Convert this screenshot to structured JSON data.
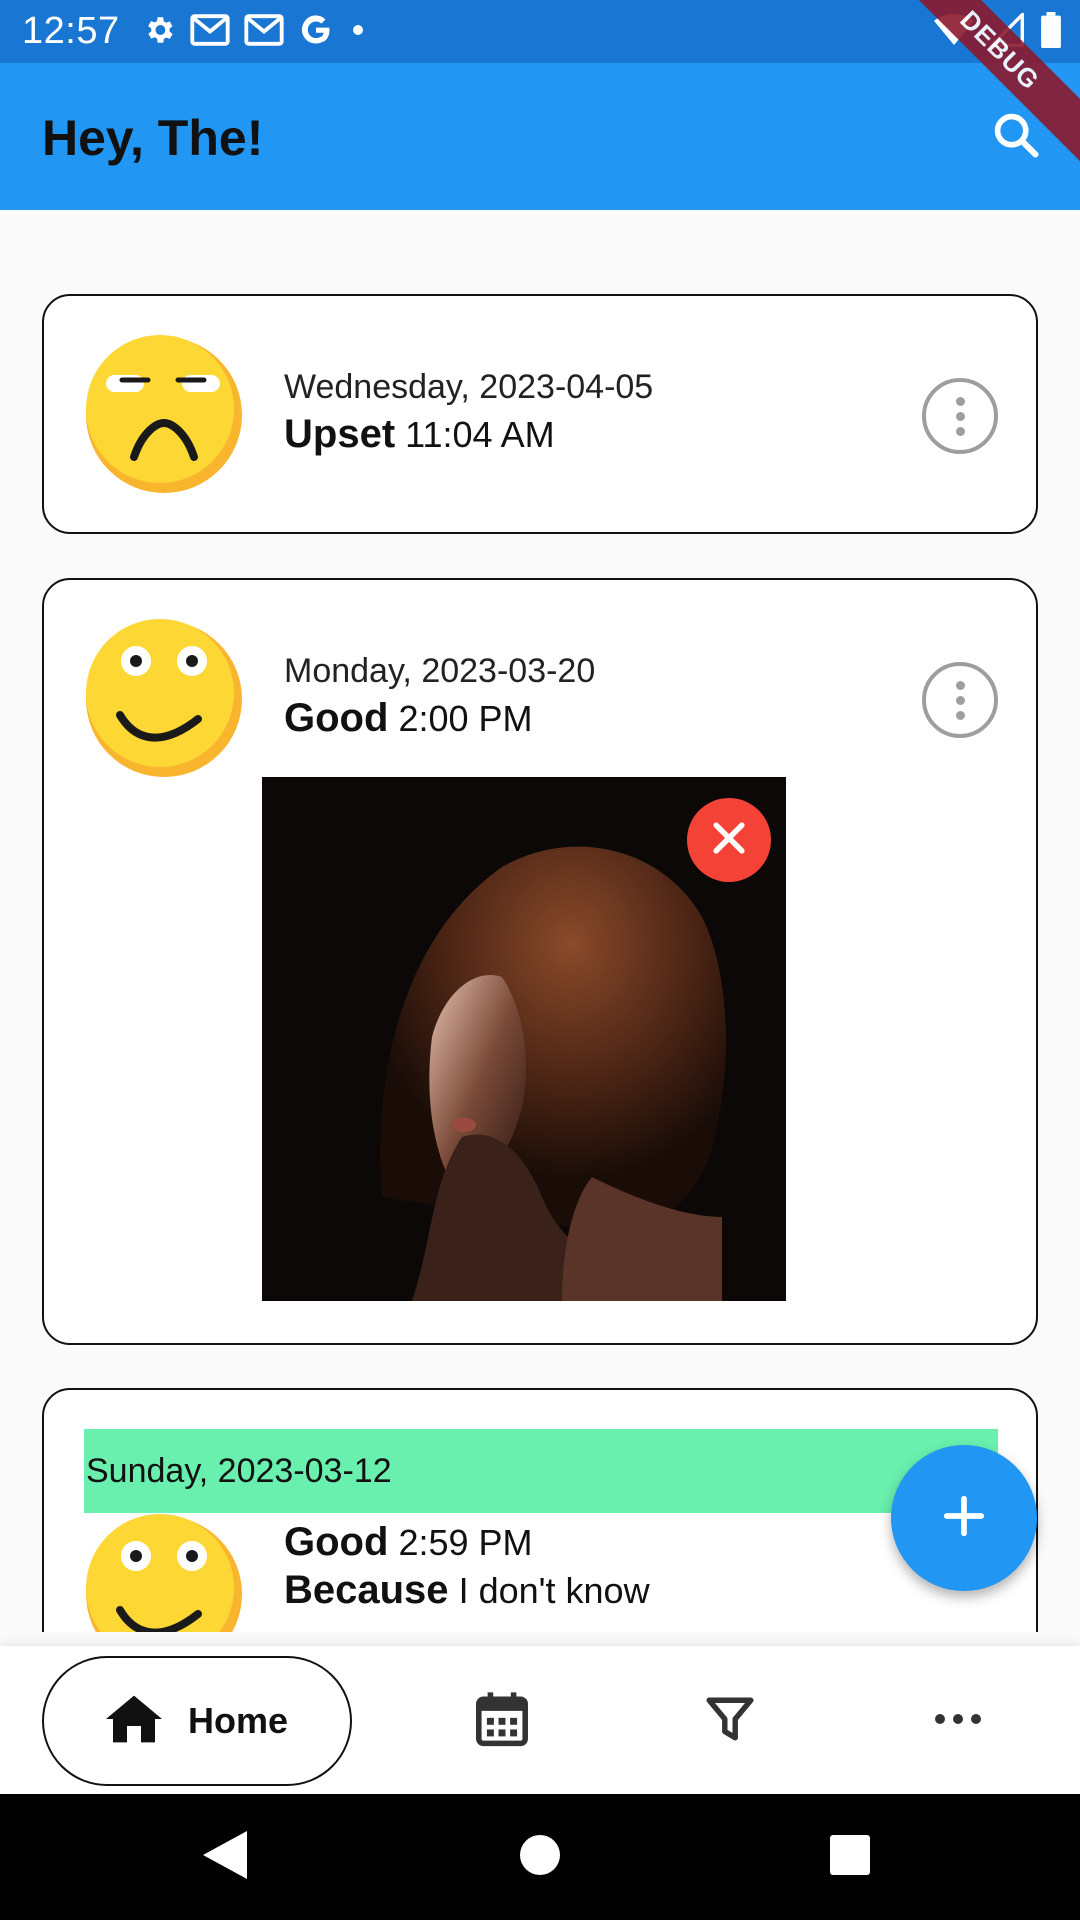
{
  "status_bar": {
    "time": "12:57",
    "left_icons": [
      "gear-icon",
      "gmail-icon",
      "gmail-icon",
      "google-icon",
      "dot-icon"
    ],
    "right_icons": [
      "wifi-icon",
      "signal-icon",
      "battery-icon"
    ]
  },
  "debug_banner": "DEBUG",
  "app_bar": {
    "title": "Hey, The!",
    "search_icon": "search-icon"
  },
  "entries": [
    {
      "date": "Wednesday, 2023-04-05",
      "mood": "Upset",
      "time": "11:04 AM",
      "emoji": "upset-face"
    },
    {
      "date": "Monday, 2023-03-20",
      "mood": "Good",
      "time": "2:00 PM",
      "emoji": "smiling-face",
      "photo": "portrait-photo"
    },
    {
      "date": "Sunday, 2023-03-12",
      "mood": "Good",
      "time": "2:59 PM",
      "reason_label": "Because",
      "reason": "I don't know",
      "emoji": "smiling-face"
    }
  ],
  "fab": {
    "icon": "plus-icon"
  },
  "bottom_nav": {
    "home_label": "Home",
    "items": [
      "home-icon",
      "calendar-icon",
      "filter-icon",
      "more-horizontal-icon"
    ]
  },
  "colors": {
    "status_bar": "#1976d2",
    "app_bar": "#2196f3",
    "fab": "#2196f3",
    "date_strip": "#69f0ae",
    "close": "#f44336",
    "emoji": "#fdd835"
  }
}
